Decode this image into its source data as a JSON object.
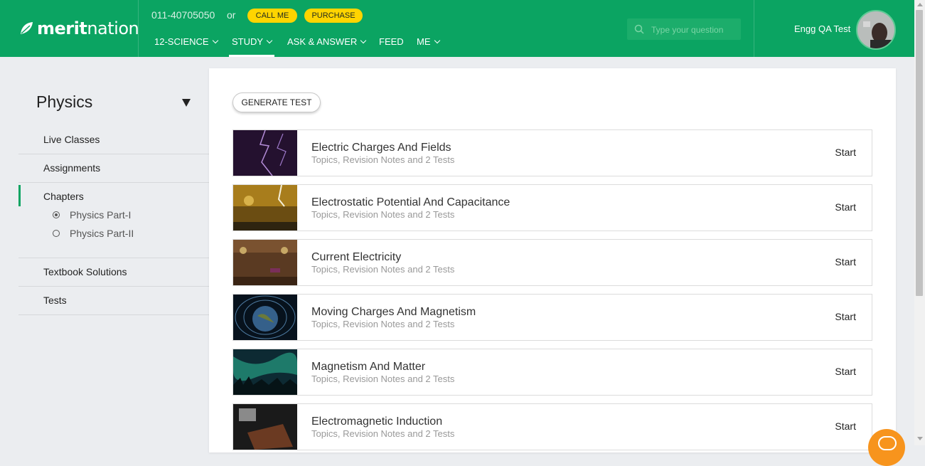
{
  "header": {
    "logo_left": "merit",
    "logo_right": "nation",
    "phone": "011-40705050",
    "or_text": "or",
    "call_me": "CALL ME",
    "purchase": "PURCHASE",
    "nav": [
      {
        "label": "12-SCIENCE"
      },
      {
        "label": "STUDY"
      },
      {
        "label": "ASK & ANSWER"
      },
      {
        "label": "FEED"
      },
      {
        "label": "ME"
      }
    ],
    "active_nav": "STUDY",
    "search_placeholder": "Type your question",
    "user_name": "Engg QA Test",
    "brand_color": "#0ba462",
    "accent_color": "#ffd400"
  },
  "sidebar": {
    "subject": "Physics",
    "items": [
      {
        "label": "Live Classes"
      },
      {
        "label": "Assignments"
      },
      {
        "label": "Chapters"
      },
      {
        "label": "Textbook Solutions"
      },
      {
        "label": "Tests"
      }
    ],
    "active_item": "Chapters",
    "parts": [
      {
        "label": "Physics Part-I",
        "checked": true
      },
      {
        "label": "Physics Part-II",
        "checked": false
      }
    ]
  },
  "main": {
    "generate_test": "GENERATE TEST",
    "chapters": [
      {
        "title": "Electric Charges And Fields",
        "subtitle": "Topics, Revision Notes and 2 Tests",
        "action": "Start"
      },
      {
        "title": "Electrostatic Potential And Capacitance",
        "subtitle": "Topics, Revision Notes and 2 Tests",
        "action": "Start"
      },
      {
        "title": "Current Electricity",
        "subtitle": "Topics, Revision Notes and 2 Tests",
        "action": "Start"
      },
      {
        "title": "Moving Charges And Magnetism",
        "subtitle": "Topics, Revision Notes and 2 Tests",
        "action": "Start"
      },
      {
        "title": "Magnetism And Matter",
        "subtitle": "Topics, Revision Notes and 2 Tests",
        "action": "Start"
      },
      {
        "title": "Electromagnetic Induction",
        "subtitle": "Topics, Revision Notes and 2 Tests",
        "action": "Start"
      }
    ]
  }
}
